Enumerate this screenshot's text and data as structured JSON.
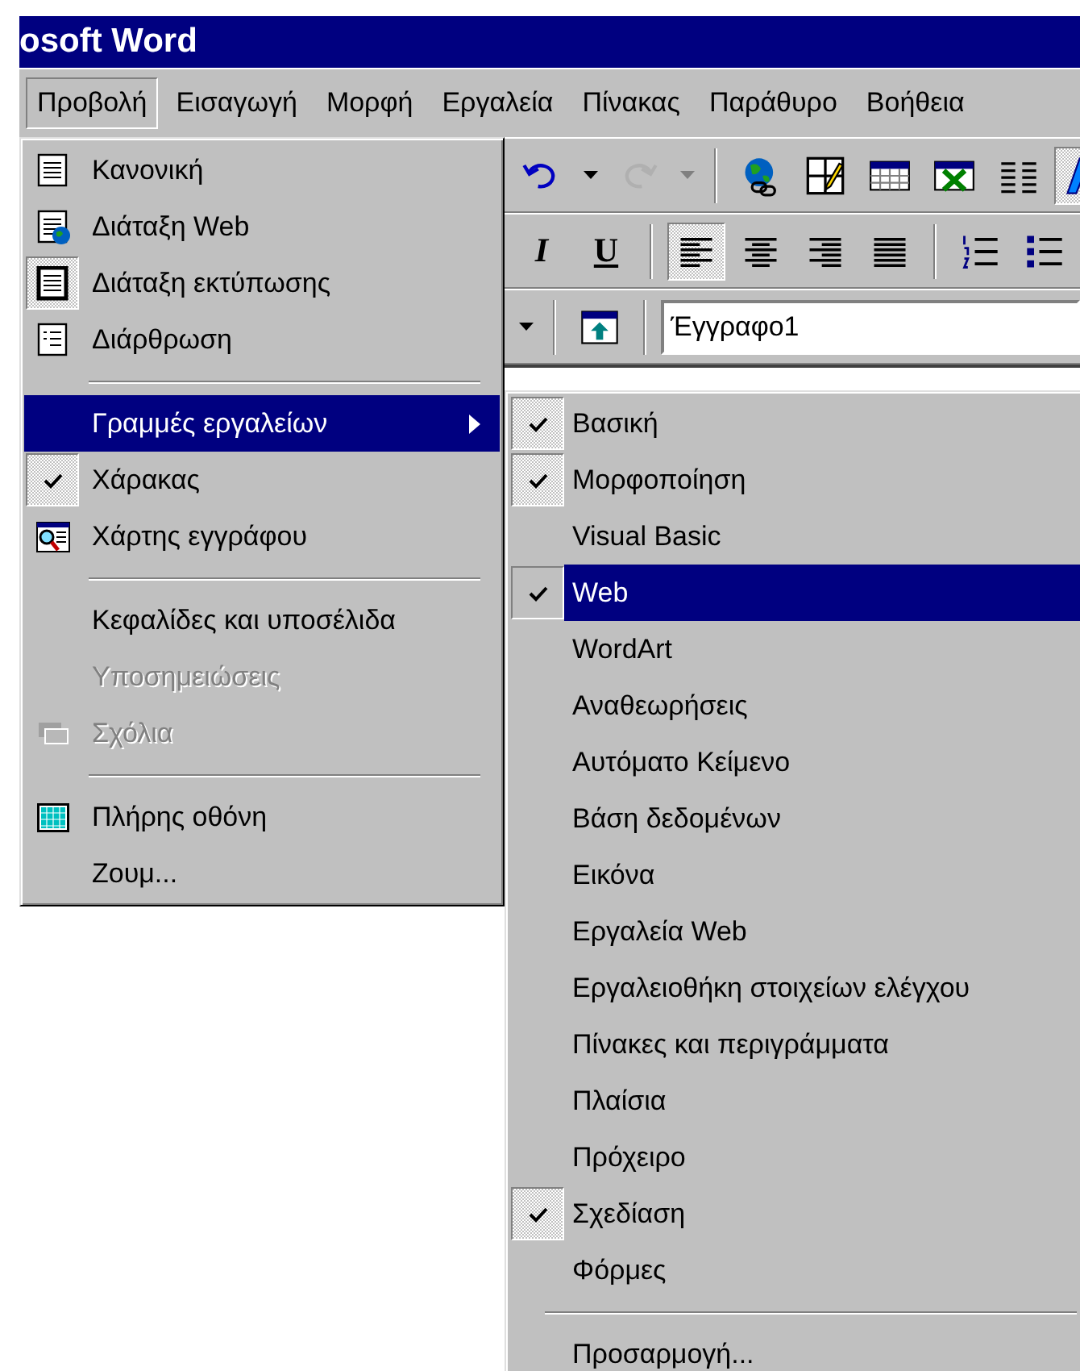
{
  "window": {
    "title": "osoft Word"
  },
  "menubar": [
    {
      "label": "Προβολή",
      "selected": true
    },
    {
      "label": "Εισαγωγή",
      "selected": false
    },
    {
      "label": "Μορφή",
      "selected": false
    },
    {
      "label": "Εργαλεία",
      "selected": false
    },
    {
      "label": "Πίνακας",
      "selected": false
    },
    {
      "label": "Παράθυρο",
      "selected": false
    },
    {
      "label": "Βοήθεια",
      "selected": false
    }
  ],
  "standard_toolbar": [
    {
      "kind": "undo",
      "pressed": false,
      "disabled": false
    },
    {
      "kind": "dropdown",
      "pressed": false,
      "disabled": false
    },
    {
      "kind": "redo",
      "pressed": false,
      "disabled": true
    },
    {
      "kind": "dropdown",
      "pressed": false,
      "disabled": true
    },
    {
      "kind": "separator"
    },
    {
      "kind": "globe",
      "pressed": false,
      "disabled": false
    },
    {
      "kind": "draw-table",
      "pressed": false,
      "disabled": false
    },
    {
      "kind": "table",
      "pressed": false,
      "disabled": false
    },
    {
      "kind": "sheet",
      "pressed": false,
      "disabled": false
    },
    {
      "kind": "columns",
      "pressed": false,
      "disabled": false
    },
    {
      "kind": "wordart",
      "pressed": true,
      "disabled": false
    }
  ],
  "formatting_toolbar": [
    {
      "kind": "italic",
      "label": "I",
      "pressed": false,
      "disabled": false
    },
    {
      "kind": "underline",
      "label": "U",
      "pressed": false,
      "disabled": false
    },
    {
      "kind": "separator"
    },
    {
      "kind": "align-left",
      "pressed": true,
      "disabled": false
    },
    {
      "kind": "align-center",
      "pressed": false,
      "disabled": false
    },
    {
      "kind": "align-right",
      "pressed": false,
      "disabled": false
    },
    {
      "kind": "justify",
      "pressed": false,
      "disabled": false
    },
    {
      "kind": "separator"
    },
    {
      "kind": "numbering",
      "pressed": false,
      "disabled": false
    },
    {
      "kind": "bullets",
      "pressed": false,
      "disabled": false
    }
  ],
  "web_toolbar": {
    "items": [
      {
        "kind": "dropdown",
        "pressed": false,
        "disabled": false
      },
      {
        "kind": "separator"
      },
      {
        "kind": "start-page",
        "pressed": false,
        "disabled": false
      },
      {
        "kind": "separator"
      }
    ],
    "address_field": {
      "value": "Έγγραφο1"
    }
  },
  "view_menu": [
    {
      "kind": "item",
      "label": "Κανονική",
      "checked": false,
      "disabled": false,
      "selected": false,
      "submenu": false
    },
    {
      "kind": "item",
      "label": "Διάταξη Web",
      "checked": false,
      "disabled": false,
      "selected": false,
      "submenu": false
    },
    {
      "kind": "item",
      "label": "Διάταξη εκτύπωσης",
      "checked": true,
      "disabled": false,
      "selected": false,
      "submenu": false
    },
    {
      "kind": "item",
      "label": "Διάρθρωση",
      "checked": false,
      "disabled": false,
      "selected": false,
      "submenu": false
    },
    {
      "kind": "separator"
    },
    {
      "kind": "item",
      "label": "Γραμμές εργαλείων",
      "checked": false,
      "disabled": false,
      "selected": true,
      "submenu": true
    },
    {
      "kind": "item",
      "label": "Χάρακας",
      "checked": true,
      "disabled": false,
      "selected": false,
      "submenu": false
    },
    {
      "kind": "item",
      "label": "Χάρτης εγγράφου",
      "checked": false,
      "disabled": false,
      "selected": false,
      "submenu": false
    },
    {
      "kind": "separator"
    },
    {
      "kind": "item",
      "label": "Κεφαλίδες και υποσέλιδα",
      "checked": false,
      "disabled": false,
      "selected": false,
      "submenu": false
    },
    {
      "kind": "item",
      "label": "Υποσημειώσεις",
      "checked": false,
      "disabled": true,
      "selected": false,
      "submenu": false
    },
    {
      "kind": "item",
      "label": "Σχόλια",
      "checked": false,
      "disabled": true,
      "selected": false,
      "submenu": false
    },
    {
      "kind": "separator"
    },
    {
      "kind": "item",
      "label": "Πλήρης οθόνη",
      "checked": false,
      "disabled": false,
      "selected": false,
      "submenu": false
    },
    {
      "kind": "item",
      "label": "Ζουμ...",
      "checked": false,
      "disabled": false,
      "selected": false,
      "submenu": false
    }
  ],
  "toolbars_submenu": [
    {
      "kind": "item",
      "label": "Βασική",
      "checked": true,
      "selected": false
    },
    {
      "kind": "item",
      "label": "Μορφοποίηση",
      "checked": true,
      "selected": false
    },
    {
      "kind": "item",
      "label": "Visual Basic",
      "checked": false,
      "selected": false
    },
    {
      "kind": "item",
      "label": "Web",
      "checked": true,
      "selected": true
    },
    {
      "kind": "item",
      "label": "WordArt",
      "checked": false,
      "selected": false
    },
    {
      "kind": "item",
      "label": "Αναθεωρήσεις",
      "checked": false,
      "selected": false
    },
    {
      "kind": "item",
      "label": "Αυτόματο Κείμενο",
      "checked": false,
      "selected": false
    },
    {
      "kind": "item",
      "label": "Βάση δεδομένων",
      "checked": false,
      "selected": false
    },
    {
      "kind": "item",
      "label": "Εικόνα",
      "checked": false,
      "selected": false
    },
    {
      "kind": "item",
      "label": "Εργαλεία Web",
      "checked": false,
      "selected": false
    },
    {
      "kind": "item",
      "label": "Εργαλειοθήκη στοιχείων ελέγχου",
      "checked": false,
      "selected": false
    },
    {
      "kind": "item",
      "label": "Πίνακες και περιγράμματα",
      "checked": false,
      "selected": false
    },
    {
      "kind": "item",
      "label": "Πλαίσια",
      "checked": false,
      "selected": false
    },
    {
      "kind": "item",
      "label": "Πρόχειρο",
      "checked": false,
      "selected": false
    },
    {
      "kind": "item",
      "label": "Σχεδίαση",
      "checked": true,
      "selected": false
    },
    {
      "kind": "item",
      "label": "Φόρμες",
      "checked": false,
      "selected": false
    },
    {
      "kind": "separator"
    },
    {
      "kind": "item",
      "label": "Προσαρμογή...",
      "checked": false,
      "selected": false
    }
  ]
}
